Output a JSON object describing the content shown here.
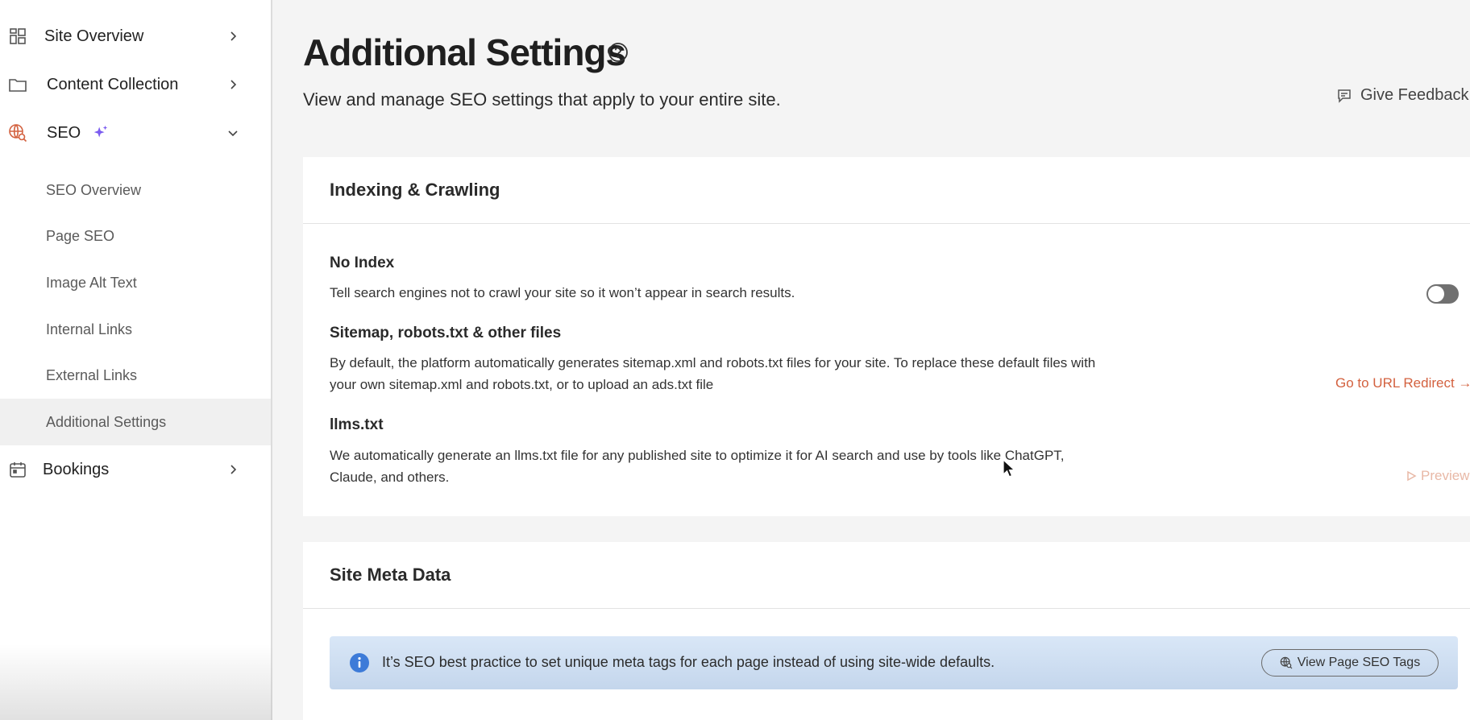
{
  "sidebar": {
    "site_overview": "Site Overview",
    "content_collection": "Content Collection",
    "seo": "SEO",
    "bookings": "Bookings",
    "seo_items": [
      {
        "label": "SEO Overview"
      },
      {
        "label": "Page SEO"
      },
      {
        "label": "Image Alt Text"
      },
      {
        "label": "Internal Links"
      },
      {
        "label": "External Links"
      },
      {
        "label": "Additional Settings",
        "active": true
      }
    ]
  },
  "header": {
    "title": "Additional Settings",
    "subtitle": "View and manage SEO settings that apply to your entire site.",
    "feedback_label": "Give Feedback"
  },
  "indexing": {
    "title": "Indexing & Crawling",
    "no_index_title": "No Index",
    "no_index_desc": "Tell search engines not to crawl your site so it won’t appear in search results.",
    "no_index_enabled": false,
    "sitemap_title": "Sitemap, robots.txt & other files",
    "sitemap_desc_1": "By default, the platform automatically generates sitemap.xml and robots.txt files for your site. To replace these default files with",
    "sitemap_desc_2": "your own sitemap.xml and robots.txt, or to upload an ads.txt file",
    "redirect_link": "Go to URL Redirect →",
    "llms_title": "llms.txt",
    "llms_desc_1": "We automatically generate an llms.txt file for any published site to optimize it for AI search and use by tools like ChatGPT,",
    "llms_desc_2": "Claude, and others.",
    "preview_link": "Preview"
  },
  "meta": {
    "title": "Site Meta Data",
    "banner_text": "It’s SEO best practice to set unique meta tags for each page instead of using site-wide defaults.",
    "banner_button": "View Page SEO Tags"
  },
  "colors": {
    "accent": "#d3613f",
    "sparkle": "#7b5cf0",
    "info": "#3d7bd8"
  }
}
